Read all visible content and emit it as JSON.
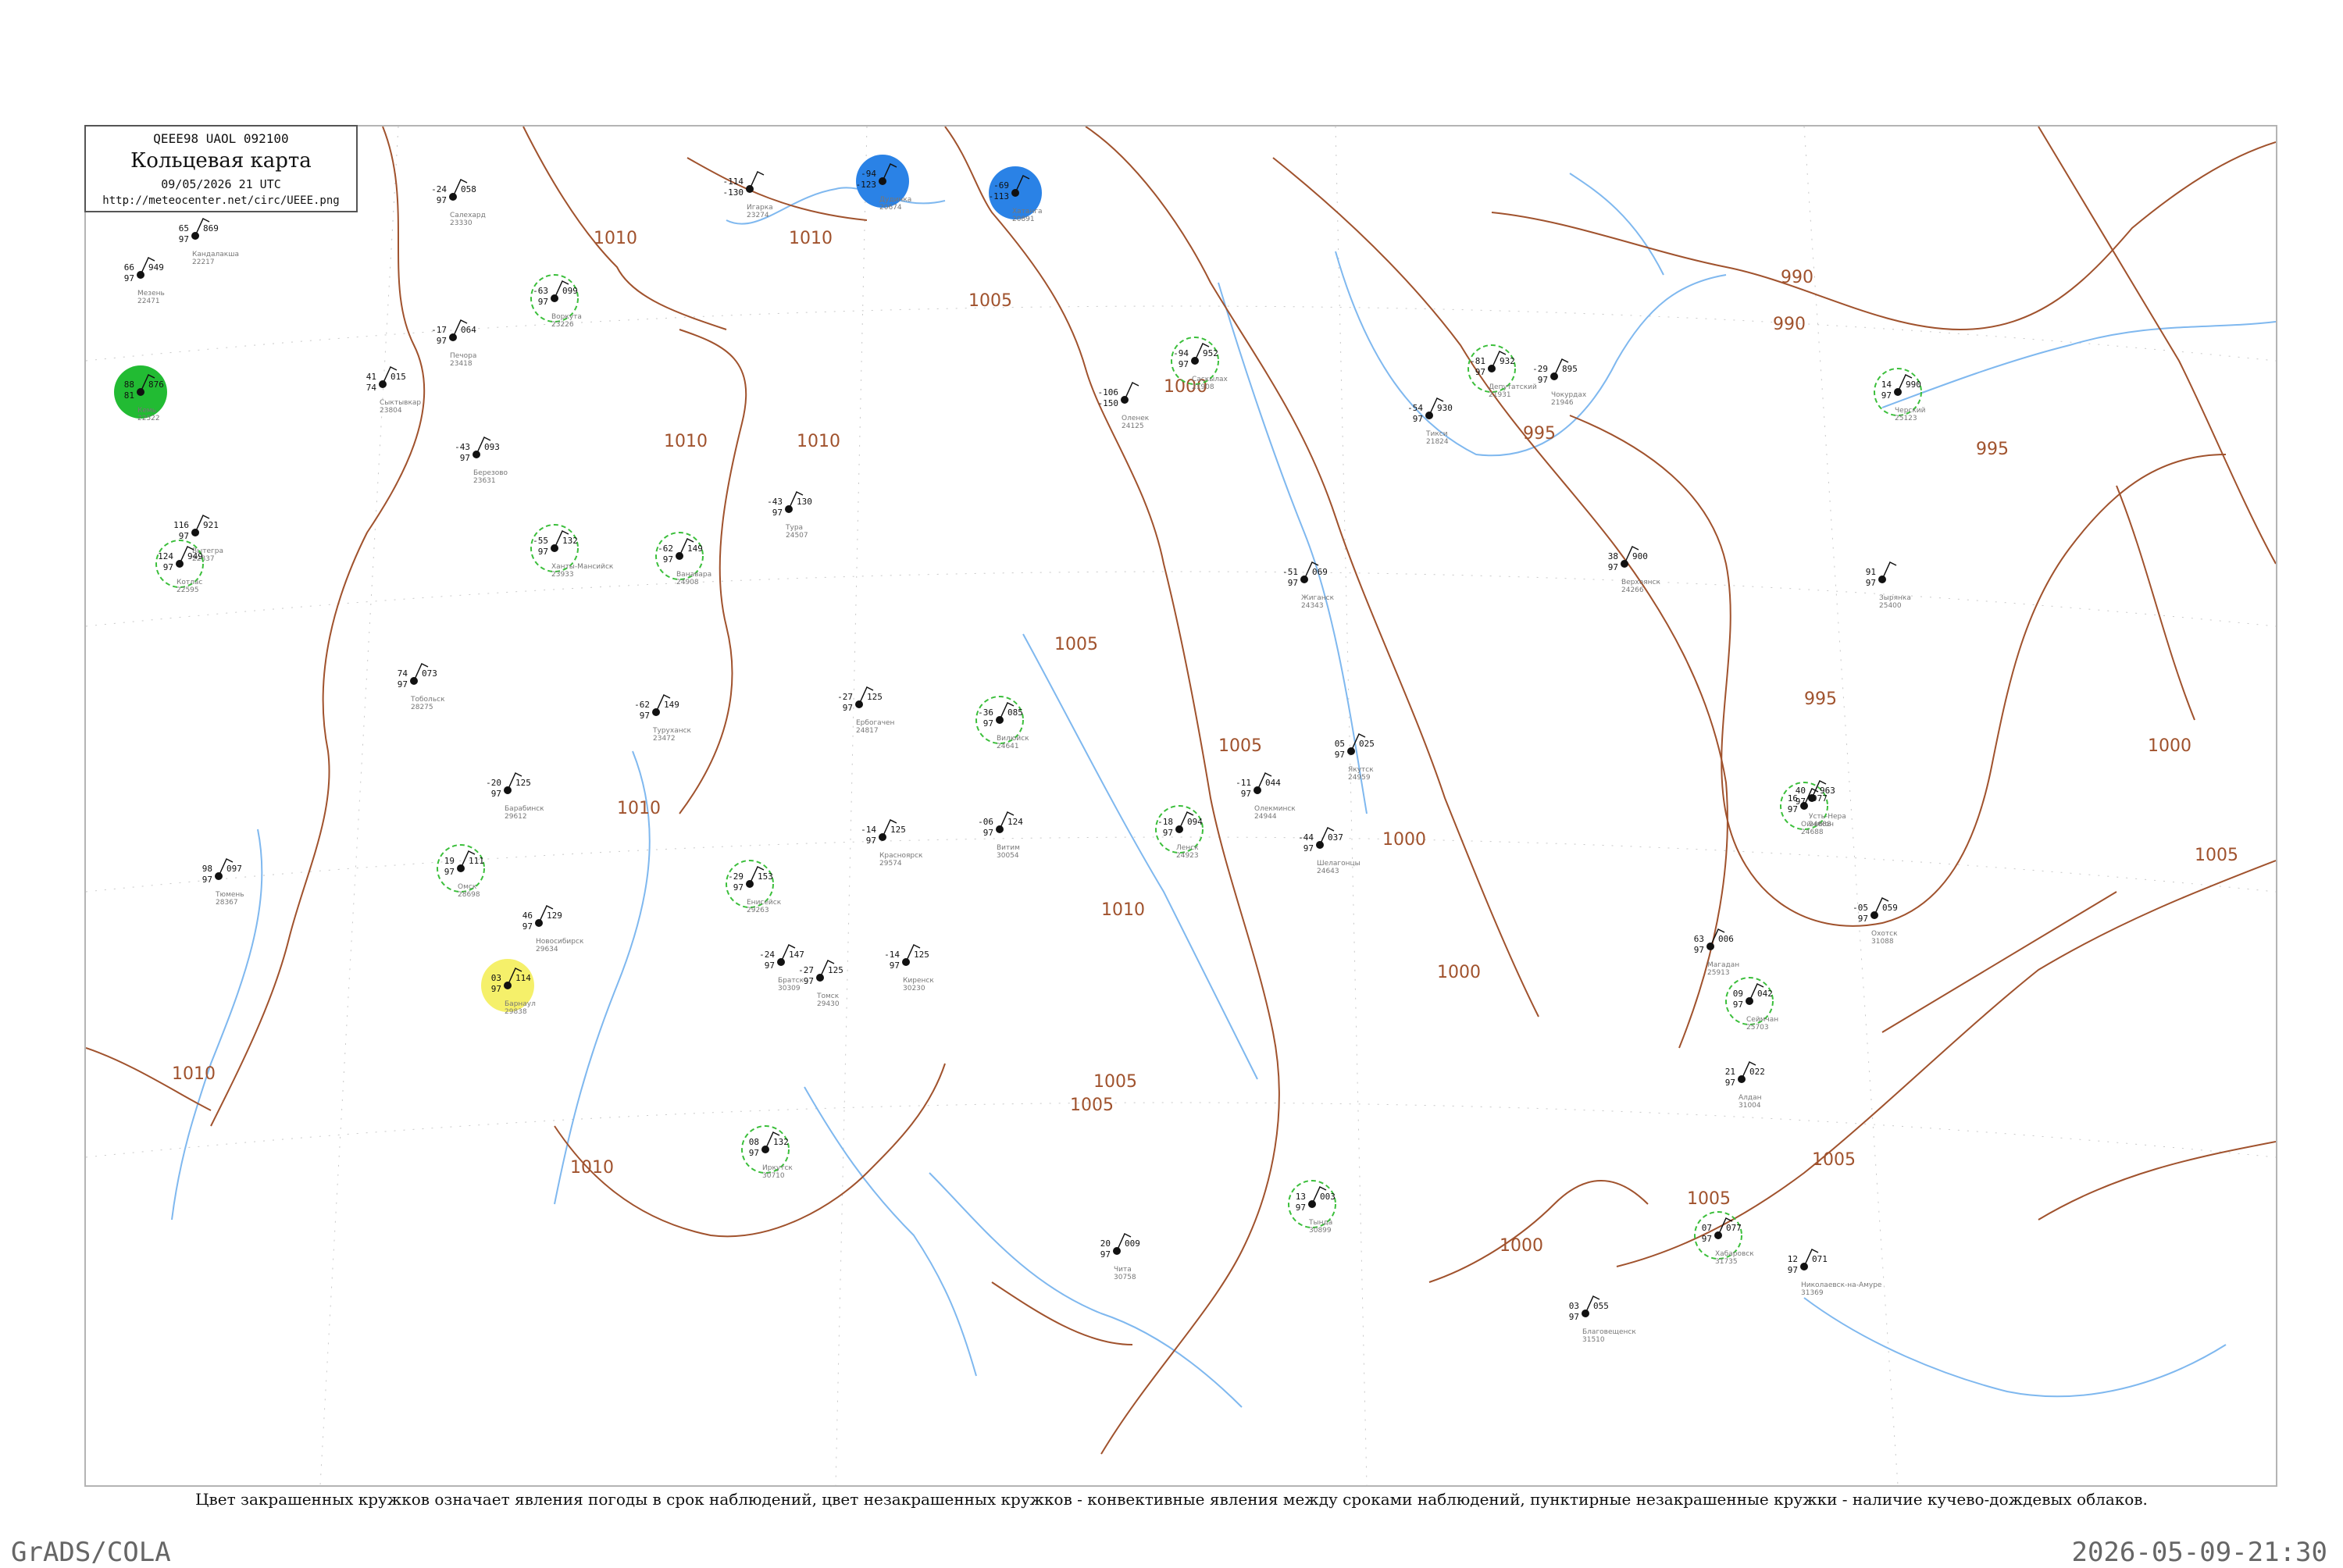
{
  "header": {
    "code": "QEEE98  UAOL  092100",
    "title": "Кольцевая карта",
    "date": "09/05/2026 21 UTC",
    "url": "http://meteocenter.net/circ/UEEE.png"
  },
  "legend_note": "Цвет закрашенных кружков означает явления погоды в срок наблюдений, цвет незакрашенных кружков - конвективные явления между сроками наблюдений, пунктирные незакрашенные кружки - наличие кучево-дождевых облаков.",
  "footer": {
    "left": "GrADS/COLA",
    "right": "2026-05-09-21:30"
  },
  "colors": {
    "isobar": "#a0522d",
    "rivers": "#7fb8ef",
    "rain_fill": "#22bb33",
    "snow_fill": "#2a82e6",
    "fog_fill": "#f5f06a",
    "storm_fill": "#e8405e",
    "light_snow_fill": "#86b7ef",
    "cb_dashed": "#3bbf3b"
  },
  "isobar_labels": [
    {
      "text": "1010"
    },
    {
      "text": "1010"
    },
    {
      "text": "1005"
    },
    {
      "text": "1000"
    },
    {
      "text": "990"
    },
    {
      "text": "995"
    },
    {
      "text": "995"
    },
    {
      "text": "995"
    },
    {
      "text": "1010"
    },
    {
      "text": "1010"
    },
    {
      "text": "1005"
    },
    {
      "text": "1005"
    },
    {
      "text": "1005"
    },
    {
      "text": "1010"
    },
    {
      "text": "1010"
    },
    {
      "text": "1000"
    },
    {
      "text": "1000"
    },
    {
      "text": "1005"
    },
    {
      "text": "1005"
    },
    {
      "text": "1000"
    },
    {
      "text": "1010"
    },
    {
      "text": "1010"
    },
    {
      "text": "990"
    },
    {
      "text": "1005"
    },
    {
      "text": "1000"
    },
    {
      "text": "1005"
    }
  ],
  "stations": [
    {
      "name": "Мезень",
      "id": "22471",
      "t": "66",
      "p": "949",
      "td": "97",
      "fill": "none"
    },
    {
      "name": "Кемь",
      "id": "22522",
      "t": "88",
      "p": "876",
      "td": "81",
      "fill": "rain"
    },
    {
      "name": "Кандалакша",
      "id": "22217",
      "t": "65",
      "p": "869",
      "td": "97",
      "fill": "none"
    },
    {
      "name": "Вытегра",
      "id": "22837",
      "t": "116",
      "p": "921",
      "td": "97",
      "fill": "none"
    },
    {
      "name": "Котлас",
      "id": "22595",
      "t": "124",
      "p": "949",
      "td": "97",
      "fill": "none"
    },
    {
      "name": "Сыктывкар",
      "id": "23804",
      "t": "41",
      "p": "015",
      "td": "74",
      "fill": "none"
    },
    {
      "name": "Печора",
      "id": "23418",
      "t": "-17",
      "p": "064",
      "td": "97",
      "fill": "none"
    },
    {
      "name": "Воркута",
      "id": "23226",
      "t": "-63",
      "p": "099",
      "td": "97",
      "fill": "none"
    },
    {
      "name": "Салехард",
      "id": "23330",
      "t": "-24",
      "p": "058",
      "td": "97",
      "fill": "none"
    },
    {
      "name": "Березово",
      "id": "23631",
      "t": "-43",
      "p": "093",
      "td": "97",
      "fill": "none"
    },
    {
      "name": "Ханты-Мансийск",
      "id": "23933",
      "t": "-55",
      "p": "132",
      "td": "97",
      "fill": "none"
    },
    {
      "name": "Тобольск",
      "id": "28275",
      "t": "74",
      "p": "073",
      "td": "97",
      "fill": "none"
    },
    {
      "name": "Тюмень",
      "id": "28367",
      "t": "98",
      "p": "097",
      "td": "97",
      "fill": "none"
    },
    {
      "name": "Омск",
      "id": "28698",
      "t": "19",
      "p": "111",
      "td": "97",
      "fill": "none"
    },
    {
      "name": "Барабинск",
      "id": "29612",
      "t": "-20",
      "p": "125",
      "td": "97",
      "fill": "none"
    },
    {
      "name": "Новосибирск",
      "id": "29634",
      "t": "46",
      "p": "129",
      "td": "97",
      "fill": "none"
    },
    {
      "name": "Барнаул",
      "id": "29838",
      "t": "03",
      "p": "114",
      "td": "97",
      "fill": "fog"
    },
    {
      "name": "Томск",
      "id": "29430",
      "t": "-27",
      "p": "125",
      "td": "97",
      "fill": "none"
    },
    {
      "name": "Красноярск",
      "id": "29574",
      "t": "-14",
      "p": "125",
      "td": "97",
      "fill": "none"
    },
    {
      "name": "Енисейск",
      "id": "29263",
      "t": "-29",
      "p": "153",
      "td": "97",
      "fill": "none"
    },
    {
      "name": "Туруханск",
      "id": "23472",
      "t": "-62",
      "p": "149",
      "td": "97",
      "fill": "none"
    },
    {
      "name": "Игарка",
      "id": "23274",
      "t": "-114",
      "p": "",
      "td": "-130",
      "fill": "none"
    },
    {
      "name": "Дудинка",
      "id": "20674",
      "t": "-94",
      "p": "",
      "td": "-123",
      "fill": "snow"
    },
    {
      "name": "Хатанга",
      "id": "20891",
      "t": "-69",
      "p": "",
      "td": "-113",
      "fill": "snow"
    },
    {
      "name": "Тура",
      "id": "24507",
      "t": "-43",
      "p": "130",
      "td": "97",
      "fill": "none"
    },
    {
      "name": "Ванавара",
      "id": "24908",
      "t": "-62",
      "p": "149",
      "td": "97",
      "fill": "none"
    },
    {
      "name": "Ербогачен",
      "id": "24817",
      "t": "-27",
      "p": "125",
      "td": "97",
      "fill": "none"
    },
    {
      "name": "Братск",
      "id": "30309",
      "t": "-24",
      "p": "147",
      "td": "97",
      "fill": "none"
    },
    {
      "name": "Иркутск",
      "id": "30710",
      "t": "08",
      "p": "132",
      "td": "97",
      "fill": "none"
    },
    {
      "name": "Киренск",
      "id": "30230",
      "t": "-14",
      "p": "125",
      "td": "97",
      "fill": "none"
    },
    {
      "name": "Витим",
      "id": "30054",
      "t": "-06",
      "p": "124",
      "td": "97",
      "fill": "none"
    },
    {
      "name": "Ленск",
      "id": "24923",
      "t": "-18",
      "p": "094",
      "td": "97",
      "fill": "none"
    },
    {
      "name": "Олекминск",
      "id": "24944",
      "t": "-11",
      "p": "044",
      "td": "97",
      "fill": "none"
    },
    {
      "name": "Якутск",
      "id": "24959",
      "t": "05",
      "p": "025",
      "td": "97",
      "fill": "none"
    },
    {
      "name": "Вилюйск",
      "id": "24641",
      "t": "-36",
      "p": "085",
      "td": "97",
      "fill": "none"
    },
    {
      "name": "Жиганск",
      "id": "24343",
      "t": "-51",
      "p": "069",
      "td": "97",
      "fill": "none"
    },
    {
      "name": "Оленек",
      "id": "24125",
      "t": "-106",
      "p": "",
      "td": "-150",
      "fill": "none"
    },
    {
      "name": "Саскылах",
      "id": "21908",
      "t": "-94",
      "p": "952",
      "td": "97",
      "fill": "none"
    },
    {
      "name": "Тикси",
      "id": "21824",
      "t": "-54",
      "p": "930",
      "td": "97",
      "fill": "none"
    },
    {
      "name": "Верхоянск",
      "id": "24266",
      "t": "38",
      "p": "900",
      "td": "97",
      "fill": "none"
    },
    {
      "name": "Оймякон",
      "id": "24688",
      "t": "16",
      "p": "977",
      "td": "97",
      "fill": "none"
    },
    {
      "name": "Зырянка",
      "id": "25400",
      "t": "91",
      "p": "",
      "td": "97",
      "fill": "none"
    },
    {
      "name": "Чокурдах",
      "id": "21946",
      "t": "-29",
      "p": "895",
      "td": "97",
      "fill": "none"
    },
    {
      "name": "Черский",
      "id": "25123",
      "t": "14",
      "p": "990",
      "td": "97",
      "fill": "none"
    },
    {
      "name": "Охотск",
      "id": "31088",
      "t": "-05",
      "p": "059",
      "td": "97",
      "fill": "none"
    },
    {
      "name": "Алдан",
      "id": "31004",
      "t": "21",
      "p": "022",
      "td": "97",
      "fill": "none"
    },
    {
      "name": "Тында",
      "id": "30899",
      "t": "13",
      "p": "003",
      "td": "97",
      "fill": "none"
    },
    {
      "name": "Чита",
      "id": "30758",
      "t": "20",
      "p": "009",
      "td": "97",
      "fill": "none"
    },
    {
      "name": "Благовещенск",
      "id": "31510",
      "t": "03",
      "p": "055",
      "td": "97",
      "fill": "none"
    },
    {
      "name": "Хабаровск",
      "id": "31735",
      "t": "07",
      "p": "077",
      "td": "97",
      "fill": "none"
    },
    {
      "name": "Николаевск-на-Амуре",
      "id": "31369",
      "t": "12",
      "p": "071",
      "td": "97",
      "fill": "none"
    },
    {
      "name": "Магадан",
      "id": "25913",
      "t": "63",
      "p": "006",
      "td": "97",
      "fill": "none"
    },
    {
      "name": "Сеймчан",
      "id": "25703",
      "t": "09",
      "p": "042",
      "td": "97",
      "fill": "none"
    },
    {
      "name": "Усть-Нера",
      "id": "24688",
      "t": "40",
      "p": "963",
      "td": "97",
      "fill": "none"
    },
    {
      "name": "Шелагонцы",
      "id": "24643",
      "t": "-44",
      "p": "037",
      "td": "97",
      "fill": "none"
    },
    {
      "name": "Депутатский",
      "id": "21931",
      "t": "-81",
      "p": "932",
      "td": "97",
      "fill": "none"
    }
  ]
}
